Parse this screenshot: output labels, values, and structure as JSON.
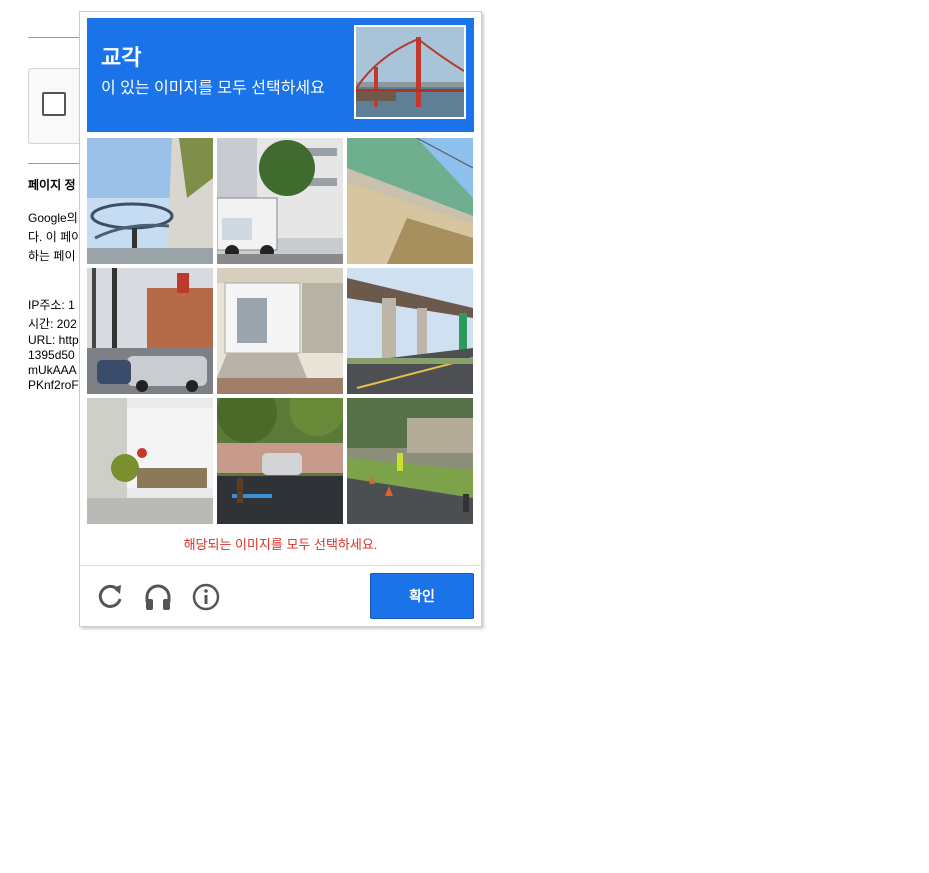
{
  "background": {
    "section_title": "페이지 정",
    "paragraph_lines": [
      "Google의",
      "다. 이 페이",
      "하는 페이"
    ],
    "info_lines": [
      "IP주소: 1",
      "시간: 202",
      "URL: http",
      "1395d50",
      "mUkAAA",
      "PKnf2roF"
    ]
  },
  "captcha": {
    "target": "교각",
    "instruction": "이 있는 이미지를 모두 선택하세요",
    "error_text": "해당되는 이미지를 모두 선택하세요.",
    "verify_label": "확인",
    "accent_color": "#1a73e8",
    "error_color": "#d93025",
    "controls": [
      "reload-icon",
      "headphones-icon",
      "info-icon"
    ],
    "tiles": [
      "spiral-ramp-bridge",
      "truck-and-apartment",
      "overpass-underside",
      "street-with-parked-cars",
      "small-white-building",
      "elevated-highway",
      "white-building-with-tree",
      "parking-lot",
      "road-with-traffic-cones"
    ]
  }
}
